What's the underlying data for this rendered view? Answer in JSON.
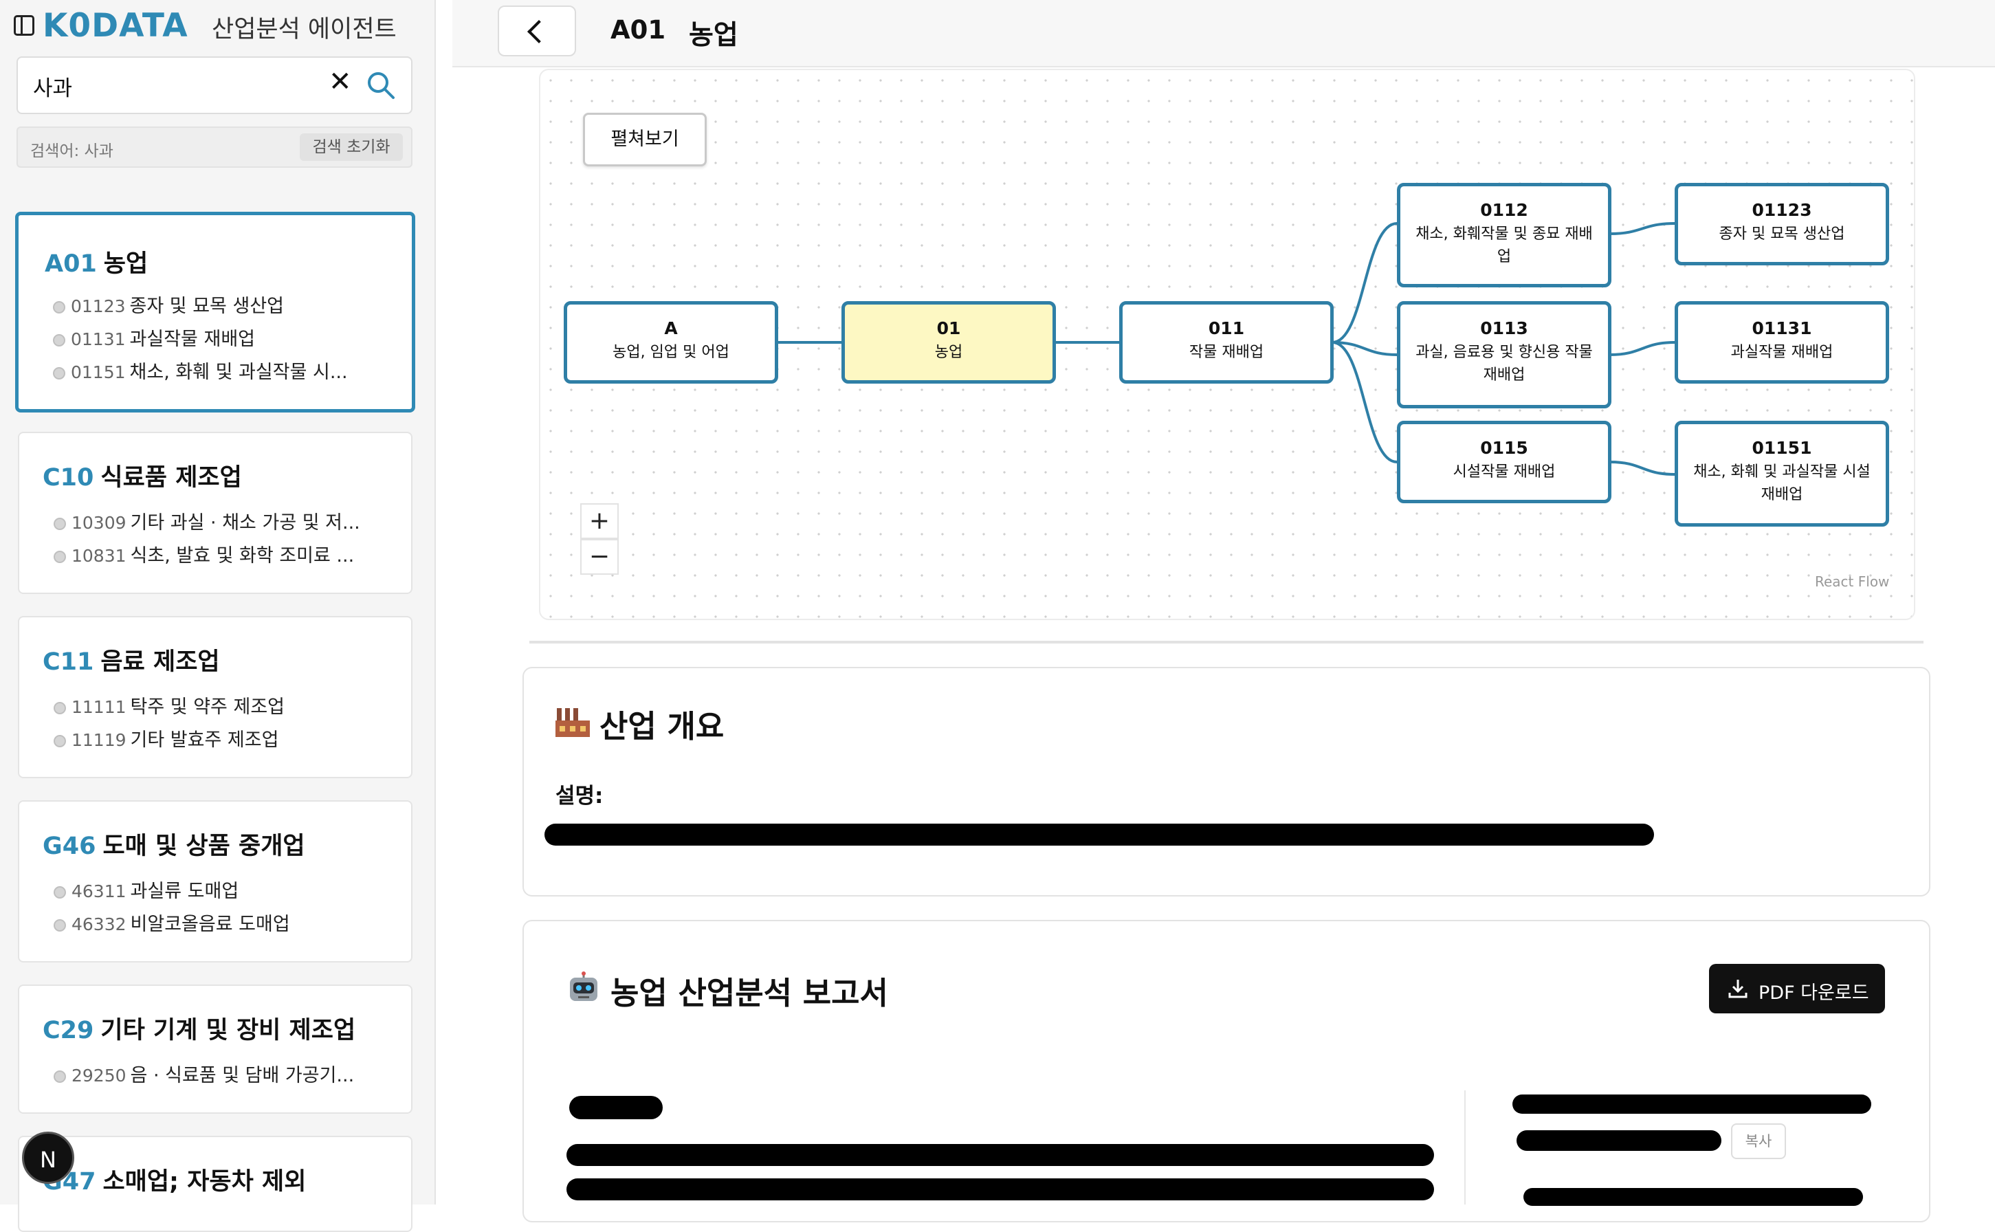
{
  "sidebar": {
    "logo": "K0DATA",
    "app_name": "산업분석 에이전트",
    "search": {
      "value": "사과",
      "info": "검색어: 사과",
      "reset_label": "검색 초기화"
    },
    "cards": [
      {
        "code": "A01",
        "title": "농업",
        "items": [
          {
            "code": "01123",
            "label": "종자 및 묘목 생산업"
          },
          {
            "code": "01131",
            "label": "과실작물 재배업"
          },
          {
            "code": "01151",
            "label": "채소, 화훼 및 과실작물 시..."
          }
        ]
      },
      {
        "code": "C10",
        "title": "식료품 제조업",
        "items": [
          {
            "code": "10309",
            "label": "기타 과실 · 채소 가공 및 저..."
          },
          {
            "code": "10831",
            "label": "식초, 발효 및 화학 조미료 ..."
          }
        ]
      },
      {
        "code": "C11",
        "title": "음료 제조업",
        "items": [
          {
            "code": "11111",
            "label": "탁주 및 약주 제조업"
          },
          {
            "code": "11119",
            "label": "기타 발효주 제조업"
          }
        ]
      },
      {
        "code": "G46",
        "title": "도매 및 상품 중개업",
        "items": [
          {
            "code": "46311",
            "label": "과실류 도매업"
          },
          {
            "code": "46332",
            "label": "비알코올음료 도매업"
          }
        ]
      },
      {
        "code": "C29",
        "title": "기타 기계 및 장비 제조업",
        "items": [
          {
            "code": "29250",
            "label": "음 · 식료품 및 담배 가공기..."
          }
        ]
      },
      {
        "code": "G47",
        "title": "소매업; 자동차 제외",
        "items": []
      }
    ],
    "badge": "N"
  },
  "header": {
    "code": "A01",
    "title": "농업"
  },
  "flow": {
    "expand_label": "펼쳐보기",
    "zoom_in": "+",
    "zoom_out": "−",
    "attribution": "React Flow",
    "nodes": {
      "a": {
        "code": "A",
        "label": "농업, 임업 및 어업"
      },
      "n01": {
        "code": "01",
        "label": "농업"
      },
      "n011": {
        "code": "011",
        "label": "작물 재배업"
      },
      "n0112": {
        "code": "0112",
        "label": "채소, 화훼작물 및 종묘 재배업"
      },
      "n0113": {
        "code": "0113",
        "label": "과실, 음료용 및 향신용 작물 재배업"
      },
      "n0115": {
        "code": "0115",
        "label": "시설작물 재배업"
      },
      "n01123": {
        "code": "01123",
        "label": "종자 및 묘목 생산업"
      },
      "n01131": {
        "code": "01131",
        "label": "과실작물 재배업"
      },
      "n01151": {
        "code": "01151",
        "label": "채소, 화훼 및 과실작물 시설 재배업"
      }
    }
  },
  "overview": {
    "title": "산업 개요",
    "desc_label": "설명:"
  },
  "report": {
    "title": "농업 산업분석 보고서",
    "pdf_label": "PDF 다운로드",
    "copy_label": "복사"
  },
  "colors": {
    "accent": "#2f8ab5",
    "node_border": "#2f7fa6",
    "selected_node": "#fdf8c3"
  }
}
